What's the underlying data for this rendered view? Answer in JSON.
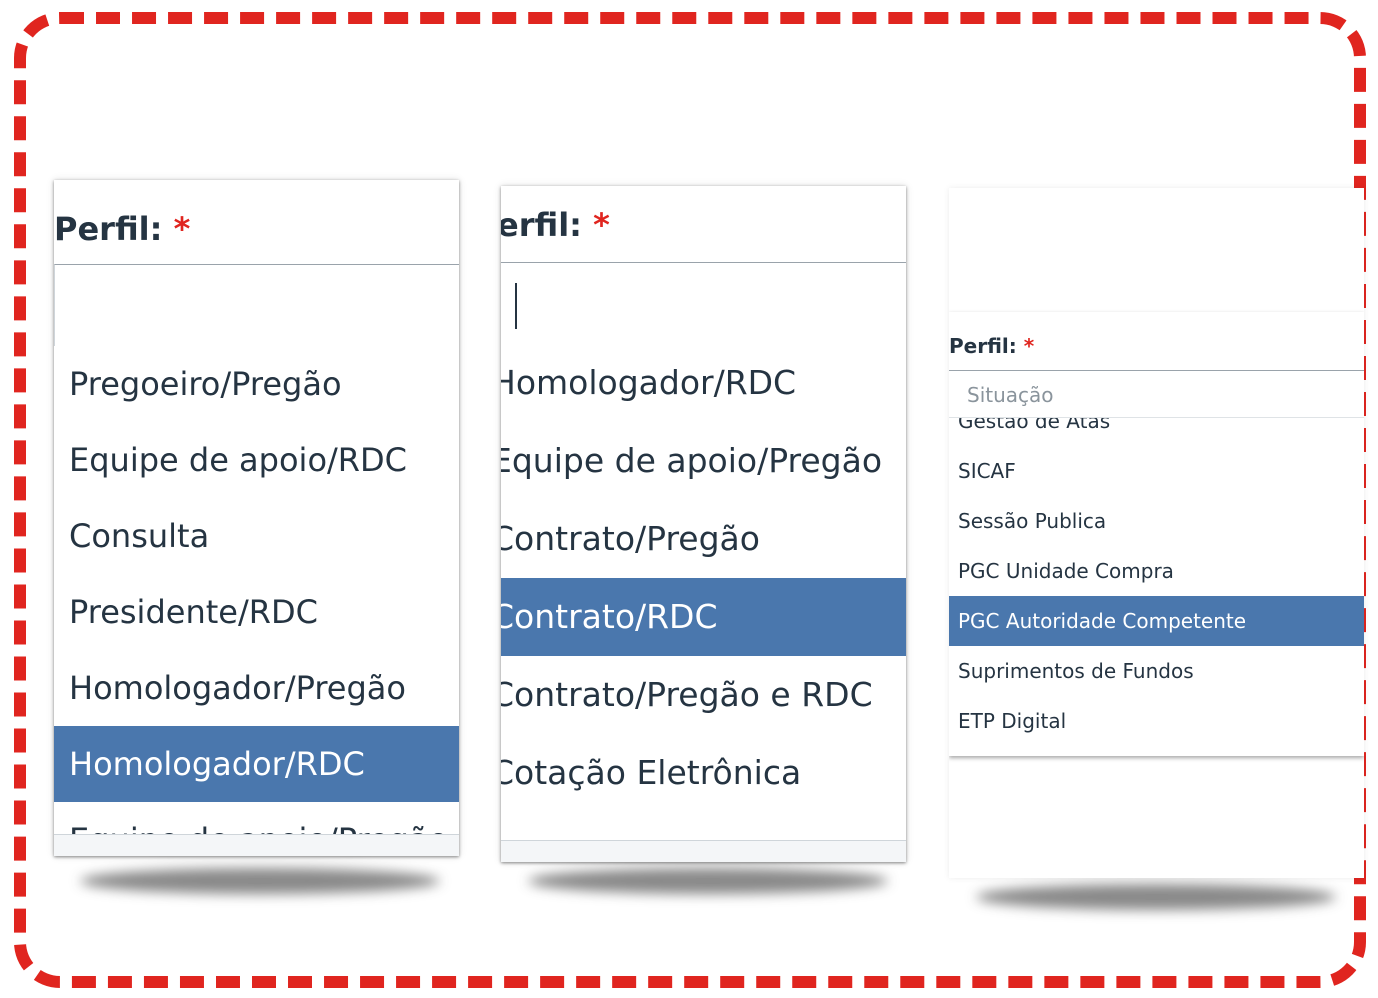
{
  "panels": [
    {
      "label": "Perfil:",
      "required_mark": "*",
      "search_value": "",
      "options": [
        "Pregoeiro/Pregão",
        "Equipe de apoio/RDC",
        "Consulta",
        "Presidente/RDC",
        "Homologador/Pregão",
        "Homologador/RDC",
        "Equipe de apoio/Pregão"
      ],
      "selected": "Homologador/RDC"
    },
    {
      "label": "erfil:",
      "required_mark": "*",
      "search_value": "",
      "options": [
        "Homologador/RDC",
        "Equipe de apoio/Pregão",
        "Contrato/Pregão",
        "Contrato/RDC",
        "Contrato/Pregão e RDC",
        "Cotação Eletrônica"
      ],
      "selected": "Contrato/RDC"
    },
    {
      "label": "Perfil:",
      "required_mark": "*",
      "search_placeholder": "Situação",
      "options": [
        "Gestão de Atas",
        "SICAF",
        "Sessão Publica",
        "PGC Unidade Compra",
        "PGC Autoridade Competente",
        "Suprimentos de Fundos",
        "ETP Digital"
      ],
      "selected": "PGC Autoridade Competente"
    }
  ],
  "colors": {
    "frame_dash": "#e0251f",
    "selected_bg": "#4a77ad",
    "required": "#e0251f",
    "text": "#253442"
  }
}
